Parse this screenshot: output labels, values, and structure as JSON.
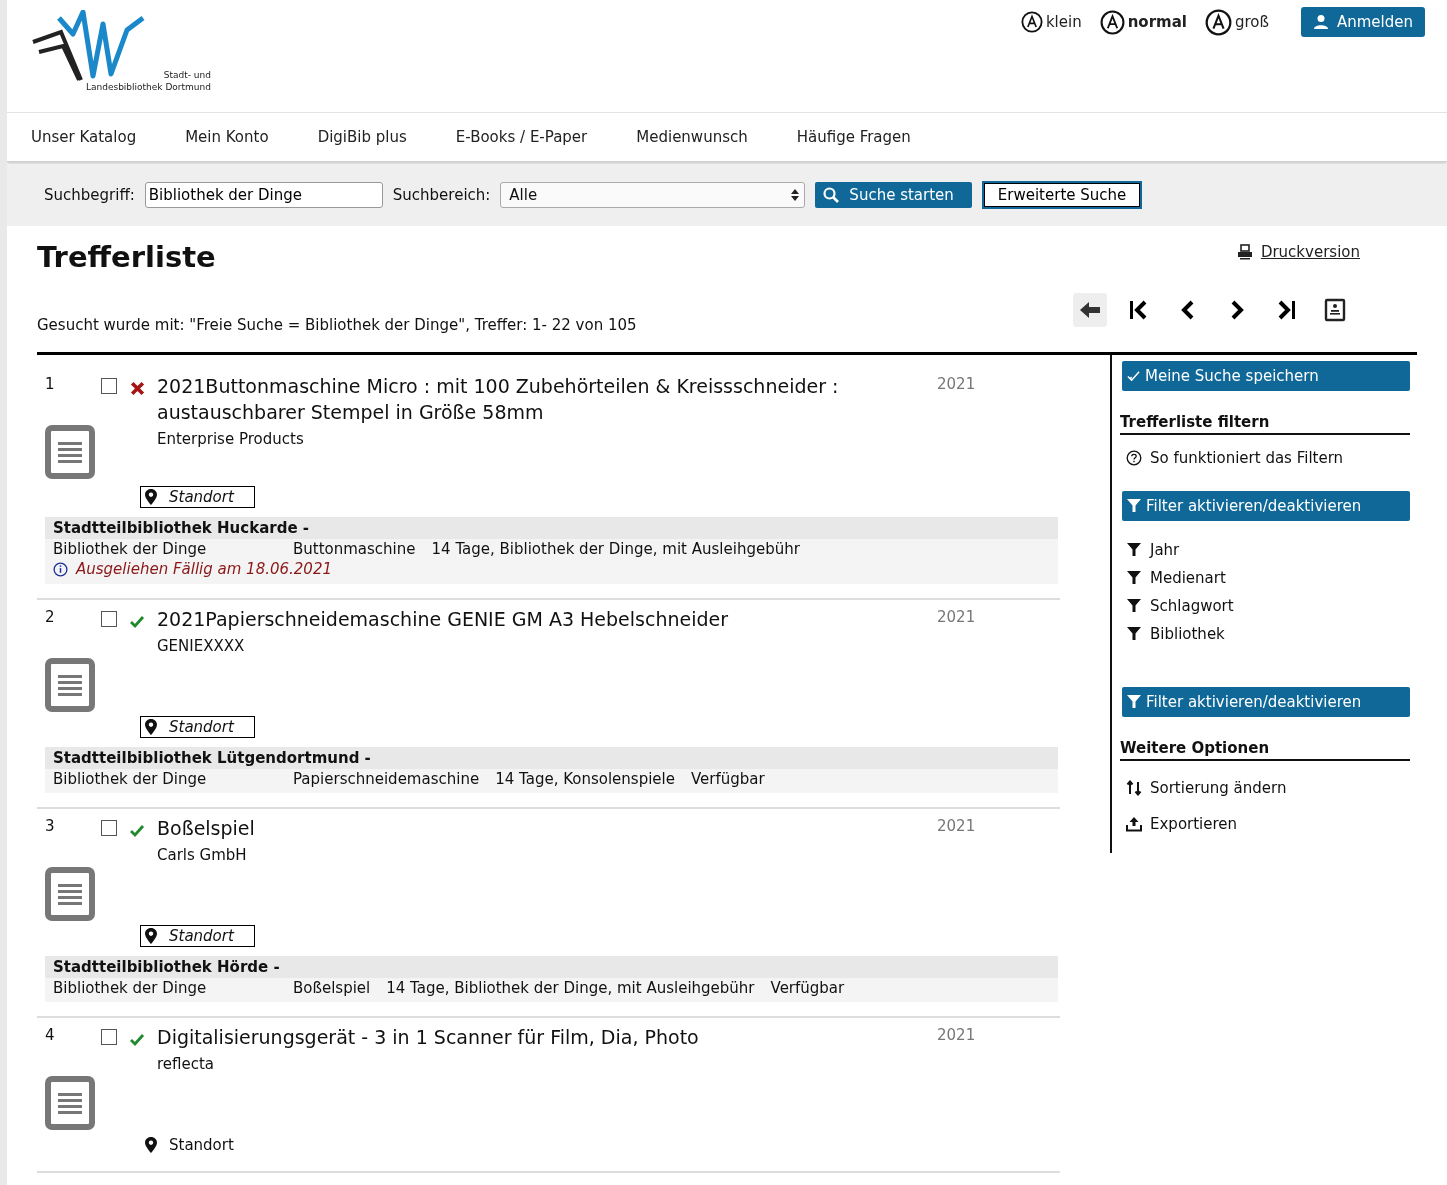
{
  "logo": {
    "line_1": "Stadt- und",
    "line_2": "Landesbibliothek Dortmund"
  },
  "font_sizes": [
    {
      "label": "klein",
      "selected": false
    },
    {
      "label": "normal",
      "selected": true
    },
    {
      "label": "groß",
      "selected": false
    }
  ],
  "login_button": "Anmelden",
  "nav": [
    "Unser Katalog",
    "Mein Konto",
    "DigiBib plus",
    "E-Books / E-Paper",
    "Medienwunsch",
    "Häufige Fragen"
  ],
  "search": {
    "term_label": "Suchbegriff:",
    "term_value": "Bibliothek der Dinge",
    "scope_label": "Suchbereich:",
    "scope_value": "Alle",
    "submit": "Suche starten",
    "advanced": "Erweiterte Suche"
  },
  "page_title": "Trefferliste",
  "print_link": "Druckversion",
  "summary": "Gesucht wurde mit: \"Freie Suche = Bibliothek der Dinge\", Treffer: 1- 22 von 105",
  "results": [
    {
      "number": "1",
      "checked": false,
      "available": false,
      "title": "2021Buttonmaschine Micro : mit 100 Zubehörteilen & Kreissschneider : austauschbarer Stempel in Größe 58mm",
      "author": "Enterprise Products",
      "year": "2021",
      "location_label": "Standort",
      "expanded": true,
      "holding": {
        "library": "Stadtteilbibliothek Huckarde -",
        "cells": [
          "Bibliothek der Dinge",
          "Buttonmaschine",
          "14 Tage, Bibliothek der Dinge, mit Ausleihgebühr"
        ],
        "status": "Ausgeliehen Fällig am 18.06.2021",
        "loaned": true
      }
    },
    {
      "number": "2",
      "checked": false,
      "available": true,
      "title": "2021Papierschneidemaschine GENIE GM A3 Hebelschneider",
      "author": "GENIEXXXX",
      "year": "2021",
      "location_label": "Standort",
      "expanded": true,
      "holding": {
        "library": "Stadtteilbibliothek Lütgendortmund -",
        "cells": [
          "Bibliothek der Dinge",
          "Papierschneidemaschine",
          "14 Tage, Konsolenspiele"
        ],
        "status": "Verfügbar",
        "loaned": false
      }
    },
    {
      "number": "3",
      "checked": false,
      "available": true,
      "title": "Boßelspiel",
      "author": "Carls GmbH",
      "year": "2021",
      "location_label": "Standort",
      "expanded": true,
      "holding": {
        "library": "Stadtteilbibliothek Hörde -",
        "cells": [
          "Bibliothek der Dinge",
          "Boßelspiel",
          "14 Tage, Bibliothek der Dinge, mit Ausleihgebühr"
        ],
        "status": "Verfügbar",
        "loaned": false
      }
    },
    {
      "number": "4",
      "checked": false,
      "available": true,
      "title": "Digitalisierungsgerät - 3 in 1 Scanner für Film, Dia, Photo",
      "author": "reflecta",
      "year": "2021",
      "location_label": "Standort",
      "expanded": false
    }
  ],
  "sidebar": {
    "save_button": "Meine Suche speichern",
    "filter_heading": "Trefferliste filtern",
    "filter_help": "So funktioniert das Filtern",
    "filter_toggle": [
      "Filter aktivieren/deaktivieren",
      "Filter aktivieren/deaktivieren"
    ],
    "filters": [
      "Jahr",
      "Medienart",
      "Schlagwort",
      "Bibliothek"
    ],
    "options_heading": "Weitere Optionen",
    "options": [
      {
        "kind": "sort",
        "label": "Sortierung ändern"
      },
      {
        "kind": "export",
        "label": "Exportieren"
      }
    ]
  }
}
